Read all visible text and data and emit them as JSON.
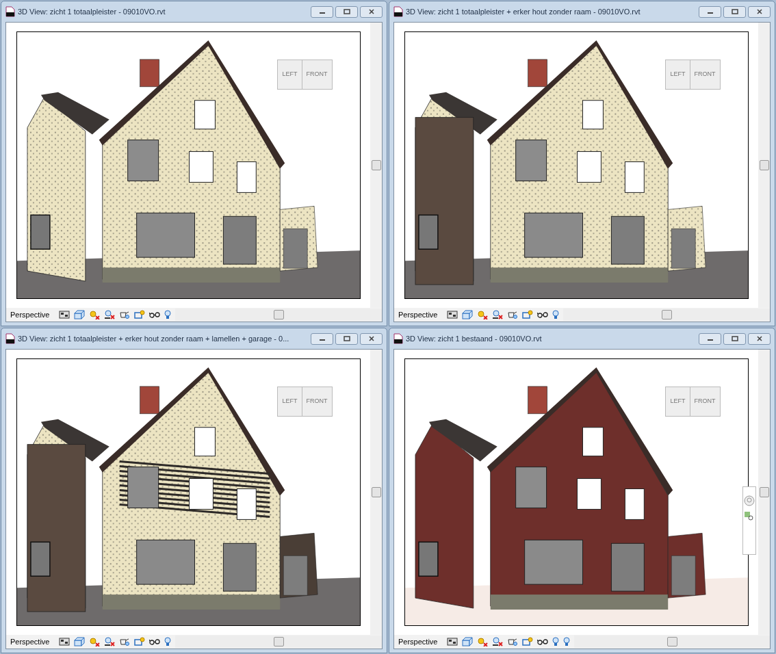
{
  "windows": [
    {
      "title": "3D View: zicht 1 totaalpleister - 09010VO.rvt",
      "kind": "plaster",
      "viewcube": {
        "left": "LEFT",
        "front": "FRONT"
      },
      "view_style": "Perspective",
      "render_icon": false,
      "navigation_bar": false
    },
    {
      "title": "3D View: zicht 1 totaalpleister + erker hout zonder raam - 09010VO.rvt",
      "kind": "wood-bay",
      "viewcube": {
        "left": "LEFT",
        "front": "FRONT"
      },
      "view_style": "Perspective",
      "render_icon": false,
      "navigation_bar": false
    },
    {
      "title": "3D View: zicht 1 totaalpleister + erker hout zonder raam + lamellen + garage - 0...",
      "kind": "slats",
      "viewcube": {
        "left": "LEFT",
        "front": "FRONT"
      },
      "view_style": "Perspective",
      "render_icon": false,
      "navigation_bar": false
    },
    {
      "title": "3D View: zicht 1 bestaand - 09010VO.rvt",
      "kind": "brick",
      "viewcube": {
        "left": "LEFT",
        "front": "FRONT"
      },
      "view_style": "Perspective",
      "render_icon": true,
      "navigation_bar": true
    }
  ]
}
